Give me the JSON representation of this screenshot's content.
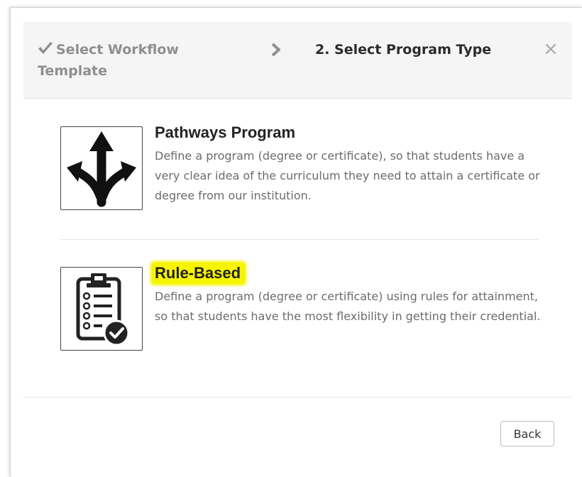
{
  "wizard": {
    "step1_label": "Select Workflow Template",
    "step2_label": "2. Select Program Type",
    "close_symbol": "×"
  },
  "options": [
    {
      "title": "Pathways Program",
      "description": "Define a program (degree or certificate), so that students have a very clear idea of the curriculum they need to attain a certificate or degree from our institution.",
      "icon": "branching-arrows-icon"
    },
    {
      "title": "Rule-Based",
      "description": "Define a program (degree or certificate) using rules for attainment, so that students have the most flexibility in getting their credential.",
      "icon": "clipboard-checklist-icon",
      "highlight_color": "#f7f400"
    }
  ],
  "footer": {
    "back_label": "Back"
  },
  "colors": {
    "header_bg": "#f5f5f5",
    "completed_step": "#8f8f8f",
    "active_step": "#2b2b2b",
    "description_text": "#6c6c6c"
  }
}
